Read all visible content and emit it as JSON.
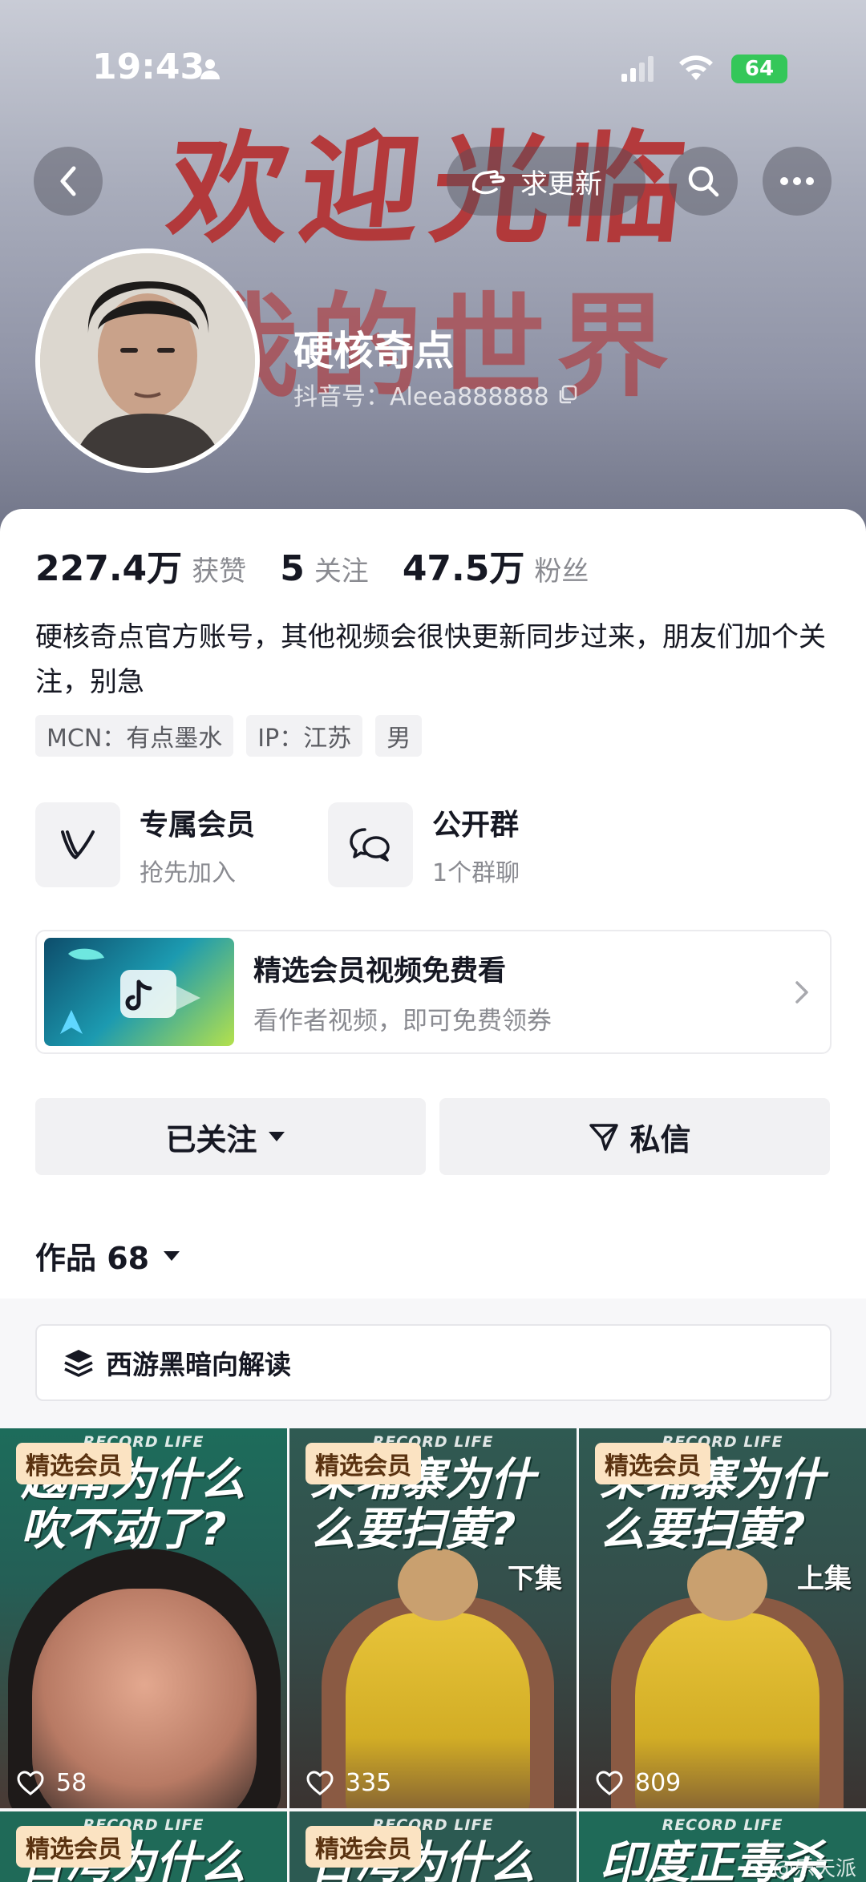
{
  "status_bar": {
    "time": "19:43",
    "battery": "64"
  },
  "banner": {
    "line1": "欢迎光临",
    "line2": "我的世界"
  },
  "top_nav": {
    "update_label": "求更新"
  },
  "profile": {
    "name": "硬核奇点",
    "douyin_id": "抖音号：Aleea888888"
  },
  "stats": [
    {
      "value": "227.4万",
      "label": "获赞"
    },
    {
      "value": "5",
      "label": "关注"
    },
    {
      "value": "47.5万",
      "label": "粉丝"
    }
  ],
  "bio": "硬核奇点官方账号，其他视频会很快更新同步过来，朋友们加个关注，别急",
  "tags": [
    "MCN：有点墨水",
    "IP：江苏",
    "男"
  ],
  "features": {
    "member": {
      "title": "专属会员",
      "subtitle": "抢先加入"
    },
    "group": {
      "title": "公开群",
      "subtitle": "1个群聊"
    }
  },
  "promo": {
    "title": "精选会员视频免费看",
    "subtitle": "看作者视频，即可免费领券"
  },
  "actions": {
    "followed": "已关注",
    "message": "私信"
  },
  "works": {
    "label": "作品 68"
  },
  "collection": {
    "label": "西游黑暗向解读"
  },
  "videos": [
    {
      "badge": "精选会员",
      "brand": "RECORD LIFE",
      "title": "越南为什么吹不动了?",
      "episode": "",
      "likes": "58"
    },
    {
      "badge": "精选会员",
      "brand": "RECORD LIFE",
      "title": "柬埔寨为什么要扫黄?",
      "episode": "下集",
      "likes": "335"
    },
    {
      "badge": "精选会员",
      "brand": "RECORD LIFE",
      "title": "柬埔寨为什么要扫黄?",
      "episode": "上集",
      "likes": "809"
    },
    {
      "badge": "精选会员",
      "brand": "RECORD LIFE",
      "title": "台湾为什么"
    },
    {
      "badge": "精选会员",
      "brand": "RECORD LIFE",
      "title": "台湾为什么"
    },
    {
      "badge": "",
      "brand": "RECORD LIFE",
      "title": "印度正毒杀"
    }
  ],
  "watermark": "@乐天派",
  "colors": {
    "accent_red": "#b52a2a",
    "battery_green": "#34c759",
    "vip_badge": "#fbe3c2"
  }
}
